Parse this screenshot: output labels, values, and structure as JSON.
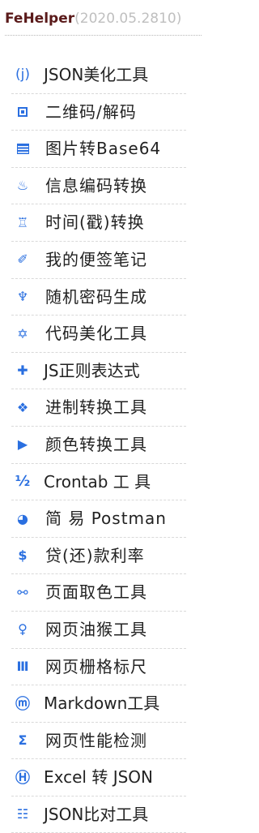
{
  "header": {
    "brand_name": "FeHelper",
    "version": "(2020.05.2810)"
  },
  "menu": [
    {
      "icon": "braces-j-icon",
      "glyph": "(j)",
      "label": "JSON美化工具"
    },
    {
      "icon": "qrcode-icon",
      "glyph": "",
      "label": "二维码/解码"
    },
    {
      "icon": "image-icon",
      "glyph": "",
      "label": "图片转Base64"
    },
    {
      "icon": "hot-springs-icon",
      "glyph": "♨",
      "label": "信息编码转换"
    },
    {
      "icon": "hourglass-icon",
      "glyph": "♖",
      "label": "时间(戳)转换"
    },
    {
      "icon": "pencil-icon",
      "glyph": "✐",
      "label": "我的便签笔记"
    },
    {
      "icon": "trident-icon",
      "glyph": "♆",
      "label": "随机密码生成"
    },
    {
      "icon": "star-of-david-icon",
      "glyph": "✡",
      "label": "代码美化工具"
    },
    {
      "icon": "plus-icon",
      "glyph": "✚",
      "label": "JS正则表达式"
    },
    {
      "icon": "diamond-icon",
      "glyph": "❖",
      "label": "进制转换工具"
    },
    {
      "icon": "play-icon",
      "glyph": "▶",
      "label": "颜色转换工具"
    },
    {
      "icon": "one-half-icon",
      "glyph": "½",
      "label": "Crontab 工 具"
    },
    {
      "icon": "pie-icon",
      "glyph": "◕",
      "label": "简 易 Postman"
    },
    {
      "icon": "dollar-icon",
      "glyph": "$",
      "label": "贷(还)款利率"
    },
    {
      "icon": "link-icon",
      "glyph": "⚯",
      "label": "页面取色工具"
    },
    {
      "icon": "female-sign-icon",
      "glyph": "♀",
      "label": "网页油猴工具"
    },
    {
      "icon": "columns-icon",
      "glyph": "Ⅲ",
      "label": "网页栅格标尺"
    },
    {
      "icon": "circled-m-icon",
      "glyph": "ⓜ",
      "label": "Markdown工具"
    },
    {
      "icon": "sigma-icon",
      "glyph": "Σ",
      "label": "网页性能检测"
    },
    {
      "icon": "circled-h-icon",
      "glyph": "Ⓗ",
      "label": "Excel 转 JSON"
    },
    {
      "icon": "list-icon",
      "glyph": "☷",
      "label": "JSON比对工具"
    }
  ],
  "colors": {
    "accent": "#2a6fe0",
    "brand": "#5a1a1a",
    "version": "#bfbfbf",
    "text": "#222222",
    "divider": "#d9d9d9"
  }
}
